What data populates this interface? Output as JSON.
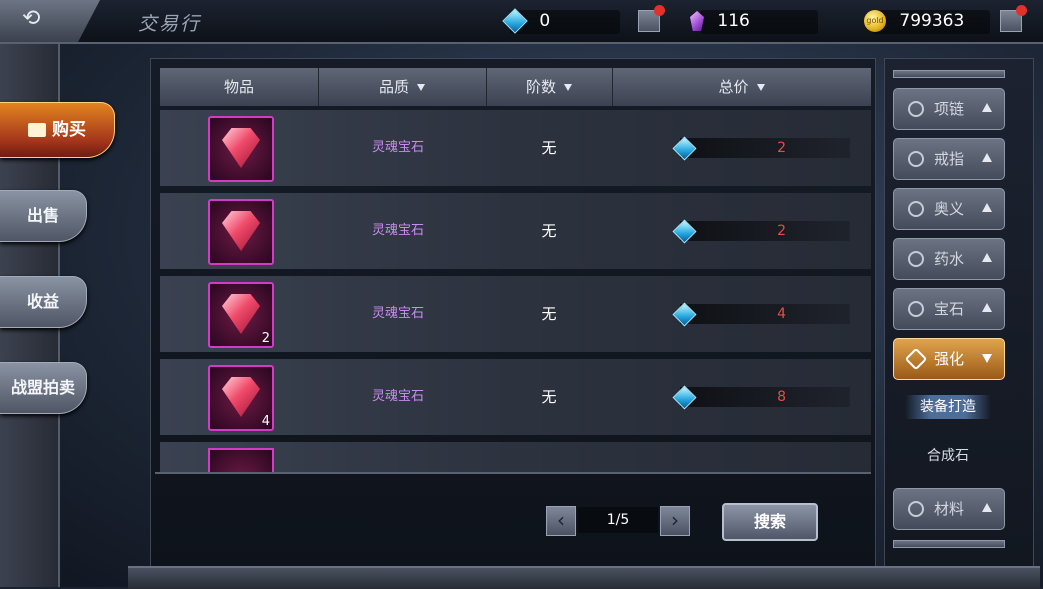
{
  "header": {
    "back_icon": "back-arrow-icon",
    "title": "交易行",
    "diamonds": "0",
    "crystals": "116",
    "gold": "799363",
    "gold_icon_text": "gold"
  },
  "left_nav": [
    {
      "label": "购买",
      "active": true
    },
    {
      "label": "出售",
      "active": false
    },
    {
      "label": "收益",
      "active": false
    },
    {
      "label": "战盟拍卖",
      "active": false
    }
  ],
  "table": {
    "columns": [
      "物品",
      "品质",
      "阶数",
      "总价"
    ],
    "rows": [
      {
        "name": "灵魂宝石",
        "stack": "",
        "tier": "无",
        "price": "2"
      },
      {
        "name": "灵魂宝石",
        "stack": "",
        "tier": "无",
        "price": "2"
      },
      {
        "name": "灵魂宝石",
        "stack": "2",
        "tier": "无",
        "price": "4"
      },
      {
        "name": "灵魂宝石",
        "stack": "4",
        "tier": "无",
        "price": "8"
      }
    ]
  },
  "pager": {
    "text": "1/5",
    "search_label": "搜索"
  },
  "categories": [
    {
      "label": "项链",
      "icon": "necklace-icon"
    },
    {
      "label": "戒指",
      "icon": "ring-icon"
    },
    {
      "label": "奥义",
      "icon": "sparkle-icon"
    },
    {
      "label": "药水",
      "icon": "potion-icon"
    },
    {
      "label": "宝石",
      "icon": "gem-icon"
    },
    {
      "label": "强化",
      "icon": "diamond-icon",
      "active": true
    },
    {
      "label": "材料",
      "icon": "bag-icon"
    }
  ],
  "subcategories": [
    {
      "label": "装备打造",
      "selected": true
    },
    {
      "label": "合成石",
      "selected": false
    }
  ],
  "colors": {
    "accent_orange": "#e2831f",
    "price_red": "#e84b45",
    "quality_purple": "#c98cf0"
  }
}
